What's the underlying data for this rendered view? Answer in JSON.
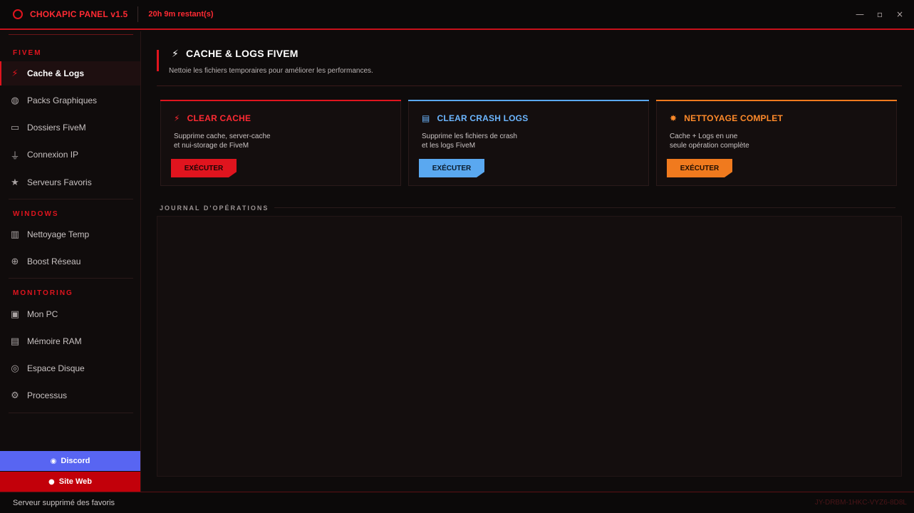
{
  "titlebar": {
    "app_title": "CHOKAPIC PANEL  v1.5",
    "time_left": "20h 9m restant(s)",
    "minimize": "—",
    "maximize": "▫",
    "close": "×"
  },
  "sidebar": {
    "sections": {
      "fivem": "FIVEM",
      "windows": "WINDOWS",
      "monitoring": "MONITORING"
    },
    "items": [
      {
        "label": "Cache & Logs",
        "icon": "lightning-icon"
      },
      {
        "label": "Packs Graphiques",
        "icon": "palette-icon"
      },
      {
        "label": "Dossiers FiveM",
        "icon": "folder-icon"
      },
      {
        "label": "Connexion IP",
        "icon": "plug-icon"
      },
      {
        "label": "Serveurs Favoris",
        "icon": "star-icon"
      },
      {
        "label": "Nettoyage Temp",
        "icon": "trash-icon"
      },
      {
        "label": "Boost Réseau",
        "icon": "globe-icon"
      },
      {
        "label": "Mon PC",
        "icon": "computer-icon"
      },
      {
        "label": "Mémoire RAM",
        "icon": "memory-icon"
      },
      {
        "label": "Espace Disque",
        "icon": "disk-icon"
      },
      {
        "label": "Processus",
        "icon": "gear-icon"
      }
    ],
    "discord_label": "Discord",
    "site_label": "Site Web"
  },
  "main": {
    "title": "CACHE & LOGS FIVEM",
    "subtitle": "Nettoie les fichiers temporaires pour améliorer les performances.",
    "cards": [
      {
        "title": "CLEAR CACHE",
        "desc_line1": "Supprime cache, server-cache",
        "desc_line2": "et nui-storage de FiveM",
        "button": "EXÉCUTER",
        "color": "#e0141e"
      },
      {
        "title": "CLEAR CRASH LOGS",
        "desc_line1": "Supprime les fichiers de crash",
        "desc_line2": "et les logs FiveM",
        "button": "EXÉCUTER",
        "color": "#5aa8f0"
      },
      {
        "title": "NETTOYAGE COMPLET",
        "desc_line1": "Cache + Logs en une",
        "desc_line2": "seule opération complète",
        "button": "EXÉCUTER",
        "color": "#f07a1e"
      }
    ],
    "journal_title": "JOURNAL D'OPÉRATIONS"
  },
  "statusbar": {
    "message": "Serveur supprimé des favoris",
    "id": "JY-DRBM-1HKC-VYZ6-8D8L"
  },
  "colors": {
    "accent": "#e0141e",
    "discord": "#5865f2",
    "site": "#c2000a"
  }
}
